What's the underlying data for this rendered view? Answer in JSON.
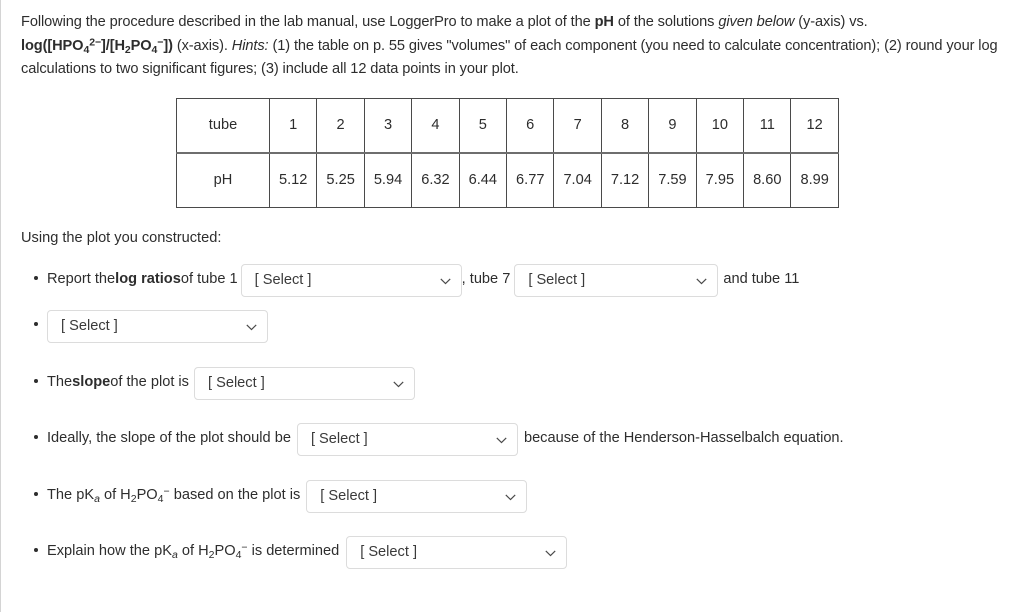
{
  "prompt": {
    "seg1": "Following the procedure described in the lab manual, use LoggerPro to make a plot of the ",
    "bold_ph": "pH",
    "seg2": " of the solutions ",
    "italic_given_below": "given below",
    "seg3": " (y-axis) vs. ",
    "bold_log": "log",
    "formula_open": "([HPO",
    "formula_sub1": "4",
    "formula_sup1": "2−",
    "formula_mid": "]/[H",
    "formula_sub2": "2",
    "formula_po": "PO",
    "formula_sub3": "4",
    "formula_sup2": "−",
    "formula_close": "])",
    "seg4": " (x-axis). ",
    "italic_hints": "Hints:",
    "seg5": " (1) the table on p. 55 gives \"volumes\" of each component (you need to calculate concentration); (2) round your log calculations to two significant figures; (3) include all 12 data points in your plot."
  },
  "table": {
    "row_labels": [
      "tube",
      "pH"
    ],
    "tubes": [
      "1",
      "2",
      "3",
      "4",
      "5",
      "6",
      "7",
      "8",
      "9",
      "10",
      "11",
      "12"
    ],
    "ph_values": [
      "5.12",
      "5.25",
      "5.94",
      "6.32",
      "6.44",
      "6.77",
      "7.04",
      "7.12",
      "7.59",
      "7.95",
      "8.60",
      "8.99"
    ]
  },
  "intro_line": "Using the plot you constructed:",
  "select_placeholder": "[ Select ]",
  "bullets": {
    "b1": {
      "t1": "Report the ",
      "bold": "log ratios",
      "t2": " of tube 1",
      "t3": ", tube 7",
      "t4": "and tube 11"
    },
    "b2": {
      "t1": "The ",
      "bold": "slope",
      "t2": " of the plot is"
    },
    "b3": {
      "t1": "Ideally, the slope of the plot should be",
      "t2": "because of the Henderson-Hasselbalch equation."
    },
    "b4": {
      "t1": "The pK",
      "sub_a": "a",
      "t2": " of H",
      "sub_2": "2",
      "t3": "PO",
      "sub_4": "4",
      "sup_minus": "−",
      "t4": " based on the plot is"
    },
    "b5": {
      "t1": "Explain how the pK",
      "sub_a": "a",
      "t2": " of H",
      "sub_2": "2",
      "t3": "PO",
      "sub_4": "4",
      "sup_minus": "−",
      "t4": " is determined"
    }
  },
  "colors": {
    "text": "#2d2d2d",
    "table_border": "#4a4a4a",
    "select_border": "#dcdcdc",
    "page_border": "#d4d4d4"
  }
}
